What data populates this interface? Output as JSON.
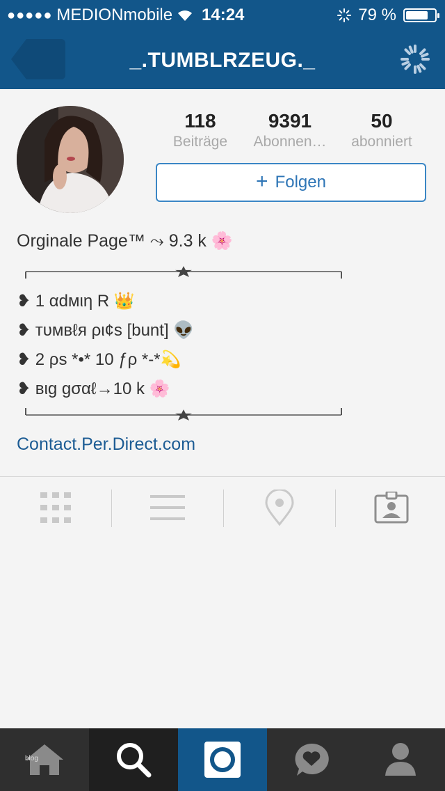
{
  "status": {
    "carrier": "MEDIONmobile",
    "time": "14:24",
    "battery": "79 %",
    "battery_level": 0.79,
    "signal_dots": "●●●●●"
  },
  "nav": {
    "title": "_.TUMBLRZEUG._",
    "back_icon": "back-arrow-icon",
    "options_icon": "loading-spinner-icon"
  },
  "profile": {
    "stats": [
      {
        "value": "118",
        "label": "Beiträge"
      },
      {
        "value": "9391",
        "label": "Abonnen…"
      },
      {
        "value": "50",
        "label": "abonniert"
      }
    ],
    "follow_label": "Folgen",
    "bio_title": "Orginale Page™ ⤳  9.3 k 🌸",
    "bio_lines": [
      "❥ 1 αdмιη R 👑",
      "❥ тυмвℓя ρι¢s [bunt] 👽",
      "❥ 2 ρs *•* 10 ƒρ *-*💫",
      "❥ вιg gσαℓ→10 k 🌸"
    ],
    "link": "Contact.Per.Direct.com"
  },
  "tabs": [
    {
      "name": "grid-icon"
    },
    {
      "name": "list-icon"
    },
    {
      "name": "location-pin-icon"
    },
    {
      "name": "tagged-photos-icon"
    }
  ],
  "tabbar": {
    "watermark": "blog",
    "items": [
      "home-icon",
      "search-icon",
      "camera-icon",
      "activity-heart-icon",
      "profile-icon"
    ],
    "accent": "#12568a"
  }
}
